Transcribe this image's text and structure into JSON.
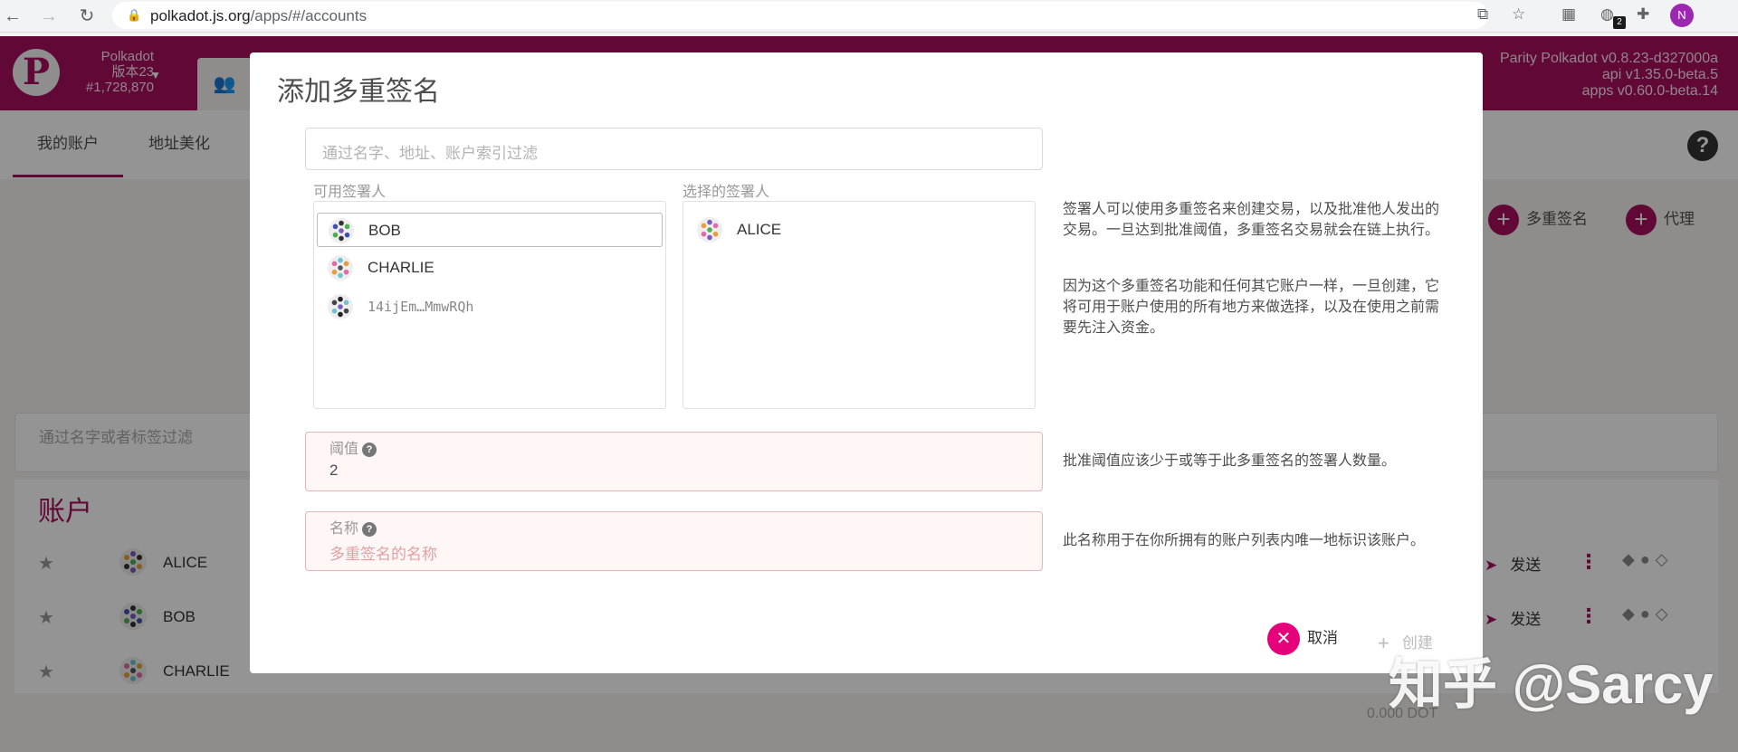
{
  "browser": {
    "url_host": "polkadot.js.org",
    "url_path": "/apps/#/accounts",
    "ext_badge": "2",
    "profile_initial": "N"
  },
  "header": {
    "chain_name": "Polkadot",
    "chain_version": "版本23",
    "block_number": "#1,728,870",
    "version_line1": "Parity Polkadot v0.8.23-d327000a",
    "version_line2": "api v1.35.0-beta.5",
    "version_line3": "apps v0.60.0-beta.14"
  },
  "subtabs": {
    "my_accounts": "我的账户",
    "vanity": "地址美化"
  },
  "background": {
    "multisig_action": "多重签名",
    "proxy_action": "代理",
    "filter_placeholder": "通过名字或者标签过滤",
    "accounts_title": "账户",
    "rows": [
      {
        "name": "ALICE",
        "send": "发送"
      },
      {
        "name": "BOB",
        "send": "发送"
      },
      {
        "name": "CHARLIE",
        "send": ""
      }
    ],
    "balance": "0.000 DOT"
  },
  "modal": {
    "title": "添加多重签名",
    "filter_placeholder": "通过名字、地址、账户索引过滤",
    "available_label": "可用签署人",
    "selected_label": "选择的签署人",
    "available": [
      "BOB",
      "CHARLIE",
      "14ijEm…MmwRQh"
    ],
    "selected": [
      "ALICE"
    ],
    "help_signers_1": "签署人可以使用多重签名来创建交易，以及批准他人发出的交易。一旦达到批准阈值，多重签名交易就会在链上执行。",
    "help_signers_2": "因为这个多重签名功能和任何其它账户一样，一旦创建，它将可用于账户使用的所有地方来做选择，以及在使用之前需要先注入资金。",
    "threshold_label": "阈值",
    "threshold_value": "2",
    "threshold_help": "批准阈值应该少于或等于此多重签名的签署人数量。",
    "name_label": "名称",
    "name_placeholder": "多重签名的名称",
    "name_help": "此名称用于在你所拥有的账户列表内唯一地标识该账户。",
    "cancel": "取消",
    "create": "创建"
  },
  "watermark": "知乎 @Sarcy"
}
